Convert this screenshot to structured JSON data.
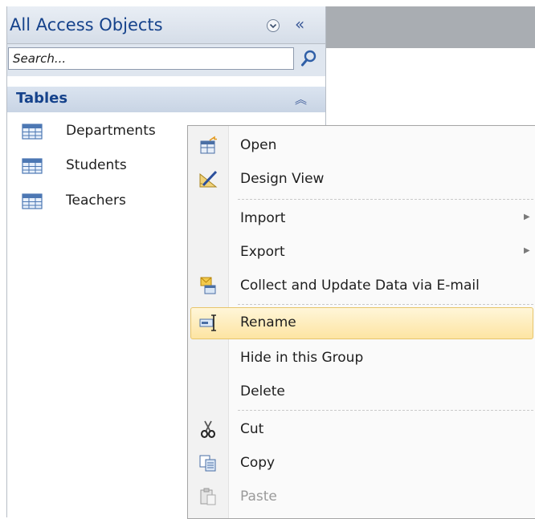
{
  "nav_pane": {
    "title": "All Access Objects",
    "search_placeholder": "Search...",
    "group": {
      "label": "Tables"
    },
    "items": [
      {
        "label": "Departments"
      },
      {
        "label": "Students"
      },
      {
        "label": "Teachers"
      }
    ]
  },
  "context_menu": {
    "items": [
      {
        "label": "Open",
        "icon": "open-icon"
      },
      {
        "label": "Design View",
        "icon": "design-view-icon"
      },
      {
        "label": "Import",
        "submenu": true
      },
      {
        "label": "Export",
        "submenu": true
      },
      {
        "label": "Collect and Update Data via E-mail",
        "icon": "collect-data-icon"
      },
      {
        "label": "Rename",
        "icon": "rename-icon",
        "highlighted": true
      },
      {
        "label": "Hide in this Group"
      },
      {
        "label": "Delete"
      },
      {
        "label": "Cut",
        "icon": "scissors-icon"
      },
      {
        "label": "Copy",
        "icon": "copy-icon"
      },
      {
        "label": "Paste",
        "icon": "paste-icon",
        "disabled": true
      }
    ]
  },
  "colors": {
    "accent_text": "#15428b",
    "highlight": "#fde4a2",
    "header_bar": "#a9adb2"
  }
}
